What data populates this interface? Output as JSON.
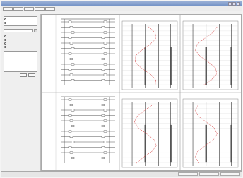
{
  "window": {
    "title": ""
  },
  "toolbar": {
    "buttons": [
      "",
      "",
      "",
      "",
      ""
    ]
  },
  "left_panel": {
    "options_group1": [
      "",
      ""
    ],
    "options_group2": [
      "",
      "",
      "",
      ""
    ],
    "list_items": [
      "",
      "",
      "",
      "",
      "",
      "",
      "",
      ""
    ],
    "buttons": [
      "",
      ""
    ]
  },
  "main": {
    "rows": [
      {
        "label": ""
      },
      {
        "label": ""
      }
    ],
    "panel_titles": [
      "",
      "",
      "",
      ""
    ]
  },
  "statusbar": {
    "panels": [
      "",
      "",
      ""
    ]
  },
  "colors": {
    "title_bar": "#6f8fc4",
    "trace_red": "#d23a3a",
    "grid": "#cfcfcf",
    "dark_bar": "#555555"
  }
}
